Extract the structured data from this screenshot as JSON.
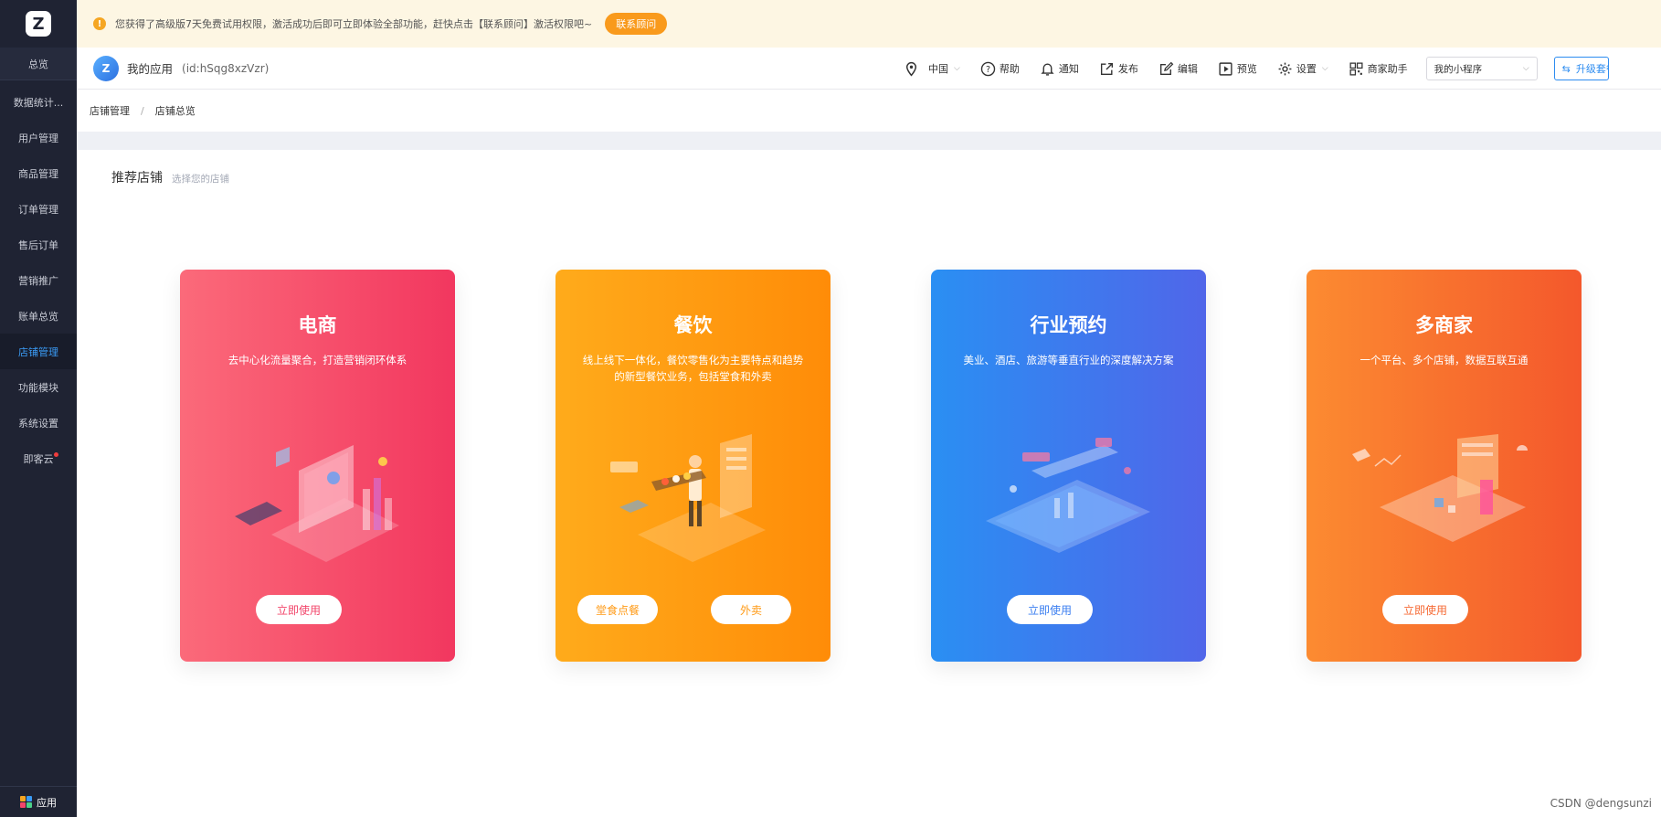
{
  "sidebar": {
    "logo_letter": "Z",
    "overview": "总览",
    "items": [
      {
        "label": "数据统计..."
      },
      {
        "label": "用户管理"
      },
      {
        "label": "商品管理"
      },
      {
        "label": "订单管理"
      },
      {
        "label": "售后订单"
      },
      {
        "label": "营销推广"
      },
      {
        "label": "账单总览"
      },
      {
        "label": "店铺管理",
        "active": true
      },
      {
        "label": "功能模块"
      },
      {
        "label": "系统设置"
      },
      {
        "label": "即客云",
        "badge_dot": true
      }
    ],
    "bottom_label": "应用"
  },
  "notice": {
    "text": "您获得了高级版7天免费试用权限，激活成功后即可立即体验全部功能，赶快点击【联系顾问】激活权限吧~",
    "button": "联系顾问"
  },
  "header": {
    "avatar_letter": "Z",
    "app_title": "我的应用",
    "app_id": "(id:hSqg8xzVzr)",
    "region": "中国",
    "help": "帮助",
    "notify": "通知",
    "publish": "发布",
    "edit": "编辑",
    "preview": "预览",
    "settings": "设置",
    "merchant_assistant": "商家助手",
    "mini_program_select": "我的小程序",
    "upgrade": "升级套餐"
  },
  "breadcrumb": {
    "parent": "店铺管理",
    "separator": "/",
    "current": "店铺总览"
  },
  "section": {
    "title": "推荐店铺",
    "subtitle": "选择您的店铺"
  },
  "cards": [
    {
      "title": "电商",
      "desc": "去中心化流量聚合，打造营销闭环体系",
      "buttons": [
        "立即使用"
      ]
    },
    {
      "title": "餐饮",
      "desc": "线上线下一体化，餐饮零售化为主要特点和趋势的新型餐饮业务，包括堂食和外卖",
      "buttons": [
        "堂食点餐",
        "外卖"
      ]
    },
    {
      "title": "行业预约",
      "desc": "美业、酒店、旅游等垂直行业的深度解决方案",
      "buttons": [
        "立即使用"
      ]
    },
    {
      "title": "多商家",
      "desc": "一个平台、多个店铺，数据互联互通",
      "buttons": [
        "立即使用"
      ]
    }
  ],
  "watermark": "CSDN @dengsunzi",
  "colors": {
    "sidebar_bg": "#1f2333",
    "active_nav": "#3a9bf5",
    "notice_btn": "#f99a1c",
    "card_ecommerce": "#f2375f",
    "card_catering": "#ff8c08",
    "card_booking": "#2a8ff3",
    "card_multi": "#f4582c"
  }
}
